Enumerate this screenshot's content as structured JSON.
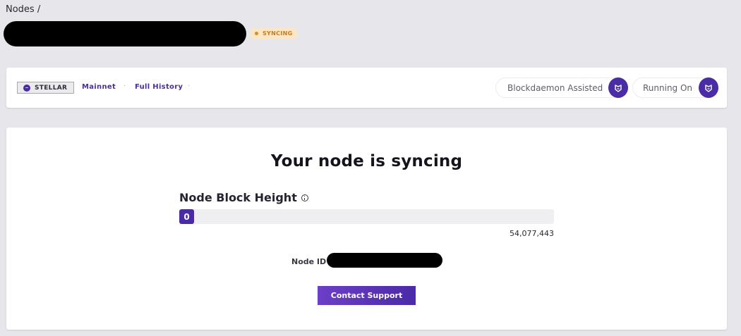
{
  "breadcrumb": {
    "label": "Nodes /"
  },
  "node": {
    "status_label": "SYNCING",
    "status_color": "#e08a1d"
  },
  "info_bar": {
    "protocol": "STELLAR",
    "network": "Mainnet",
    "node_type": "Full History",
    "separator": "·",
    "assisted_label": "Blockdaemon Assisted",
    "running_on_label": "Running On",
    "icon": "blockdaemon-logo-icon"
  },
  "main": {
    "heading": "Your node is syncing",
    "block_height_label": "Node Block Height",
    "current_height": "0",
    "target_height": "54,077,443",
    "sync_progress_fraction": 0,
    "node_id_label": "Node ID",
    "contact_button": "Contact Support"
  },
  "colors": {
    "accent": "#4b2aa7",
    "page_bg": "#e7e6ea",
    "badge_bg": "#fbe7c8"
  }
}
